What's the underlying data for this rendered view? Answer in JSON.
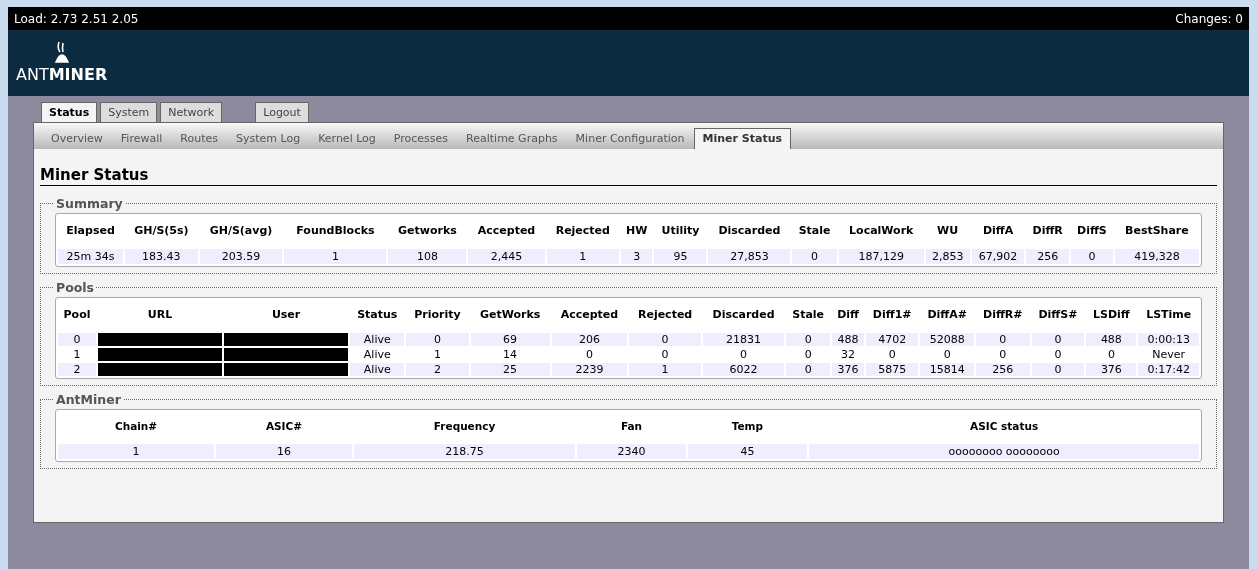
{
  "topbar": {
    "load": "Load: 2.73 2.51 2.05",
    "changes": "Changes: 0"
  },
  "logo": {
    "text": "ANT**MINER**"
  },
  "tabs": [
    {
      "label": "Status",
      "selected": true
    },
    {
      "label": "System",
      "selected": false
    },
    {
      "label": "Network",
      "selected": false
    },
    {
      "label": "Logout",
      "selected": false,
      "kind": "action"
    }
  ],
  "subtabs": [
    {
      "label": "Overview",
      "selected": false
    },
    {
      "label": "Firewall",
      "selected": false
    },
    {
      "label": "Routes",
      "selected": false
    },
    {
      "label": "System Log",
      "selected": false
    },
    {
      "label": "Kernel Log",
      "selected": false
    },
    {
      "label": "Processes",
      "selected": false
    },
    {
      "label": "Realtime Graphs",
      "selected": false
    },
    {
      "label": "Miner Configuration",
      "selected": false
    },
    {
      "label": "Miner Status",
      "selected": true
    }
  ],
  "heading": "Miner Status",
  "summary": {
    "legend": "Summary",
    "columns": [
      "Elapsed",
      "GH/S(5s)",
      "GH/S(avg)",
      "FoundBlocks",
      "Getworks",
      "Accepted",
      "Rejected",
      "HW",
      "Utility",
      "Discarded",
      "Stale",
      "LocalWork",
      "WU",
      "DiffA",
      "DiffR",
      "DiffS",
      "BestShare"
    ],
    "rows": [
      [
        "25m 34s",
        "183.43",
        "203.59",
        "1",
        "108",
        "2,445",
        "1",
        "3",
        "95",
        "27,853",
        "0",
        "187,129",
        "2,853",
        "67,902",
        "256",
        "0",
        "419,328"
      ]
    ]
  },
  "pools": {
    "legend": "Pools",
    "columns": [
      "Pool",
      "URL",
      "User",
      "Status",
      "Priority",
      "GetWorks",
      "Accepted",
      "Rejected",
      "Discarded",
      "Stale",
      "Diff",
      "Diff1#",
      "DiffA#",
      "DiffR#",
      "DiffS#",
      "LSDiff",
      "LSTime"
    ],
    "rows": [
      {
        "cells": [
          "0",
          null,
          null,
          "Alive",
          "0",
          "69",
          "206",
          "0",
          "21831",
          "0",
          "488",
          "4702",
          "52088",
          "0",
          "0",
          "488",
          "0:00:13"
        ]
      },
      {
        "cells": [
          "1",
          null,
          null,
          "Alive",
          "1",
          "14",
          "0",
          "0",
          "0",
          "0",
          "32",
          "0",
          "0",
          "0",
          "0",
          "0",
          "Never"
        ]
      },
      {
        "cells": [
          "2",
          null,
          null,
          "Alive",
          "2",
          "25",
          "2239",
          "1",
          "6022",
          "0",
          "376",
          "5875",
          "15814",
          "256",
          "0",
          "376",
          "0:17:42"
        ]
      }
    ]
  },
  "antminer": {
    "legend": "AntMiner",
    "columns": [
      "Chain#",
      "ASIC#",
      "Frequency",
      "Fan",
      "Temp",
      "ASIC status"
    ],
    "rows": [
      [
        "1",
        "16",
        "218.75",
        "2340",
        "45",
        "oooooooo oooooooo"
      ]
    ]
  }
}
